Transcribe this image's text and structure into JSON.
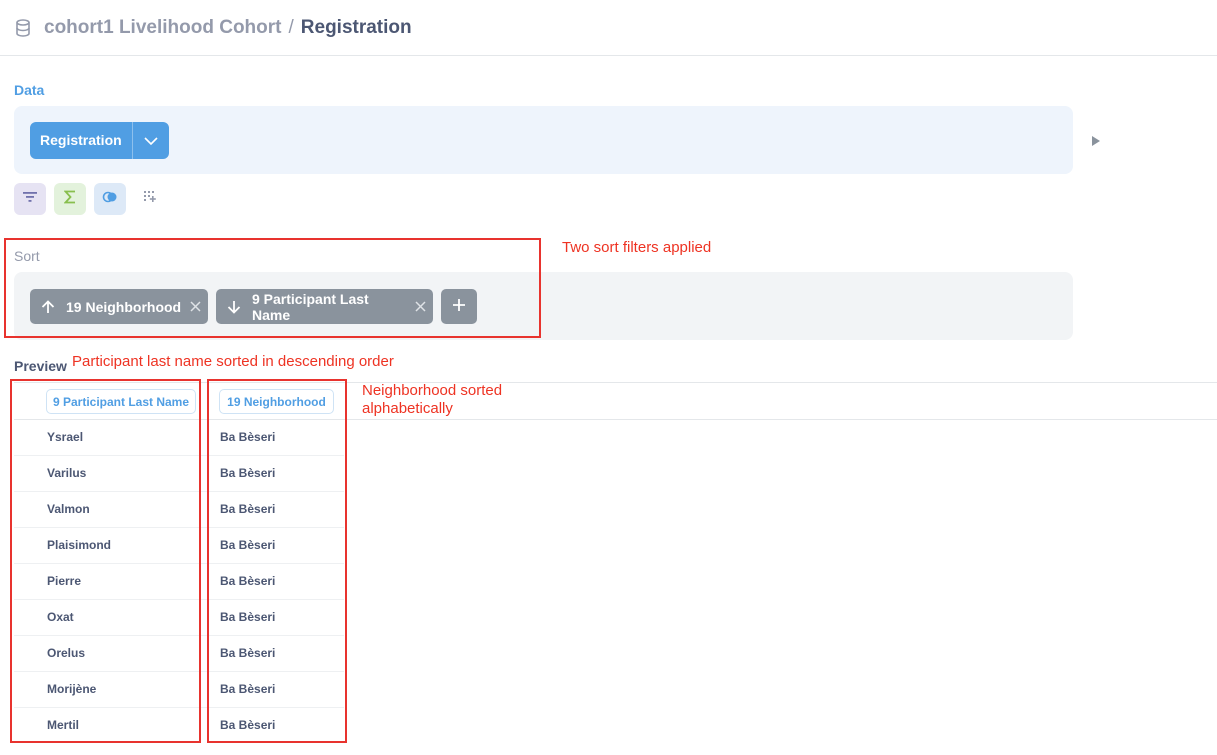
{
  "header": {
    "parent": "cohort1 Livelihood Cohort",
    "separator": "/",
    "current": "Registration"
  },
  "data_section": {
    "label": "Data",
    "table": "Registration"
  },
  "step_buttons": [
    "filter-icon",
    "sum-icon",
    "join-icon",
    "more-steps-icon"
  ],
  "sort_section": {
    "label": "Sort",
    "sorts": [
      {
        "column": "19 Neighborhood",
        "direction": "ascending"
      },
      {
        "column": "9 Participant Last Name",
        "direction": "descending"
      }
    ]
  },
  "preview": {
    "label": "Preview",
    "columns": [
      "9 Participant Last Name",
      "19 Neighborhood"
    ],
    "rows": [
      [
        "Ysrael",
        "Ba Bèseri"
      ],
      [
        "Varilus",
        "Ba Bèseri"
      ],
      [
        "Valmon",
        "Ba Bèseri"
      ],
      [
        "Plaisimond",
        "Ba Bèseri"
      ],
      [
        "Pierre",
        "Ba Bèseri"
      ],
      [
        "Oxat",
        "Ba Bèseri"
      ],
      [
        "Orelus",
        "Ba Bèseri"
      ],
      [
        "Morijène",
        "Ba Bèseri"
      ],
      [
        "Mertil",
        "Ba Bèseri"
      ]
    ]
  },
  "annotations": {
    "sort_note": "Two sort filters applied",
    "last_name_note": "Participant last name sorted in descending order",
    "neighborhood_note_line1": "Neighborhood sorted",
    "neighborhood_note_line2": "alphabetically"
  },
  "colors": {
    "brand": "#509ee3",
    "sort_chip": "#8a939d",
    "annotation": "#ee3323"
  }
}
